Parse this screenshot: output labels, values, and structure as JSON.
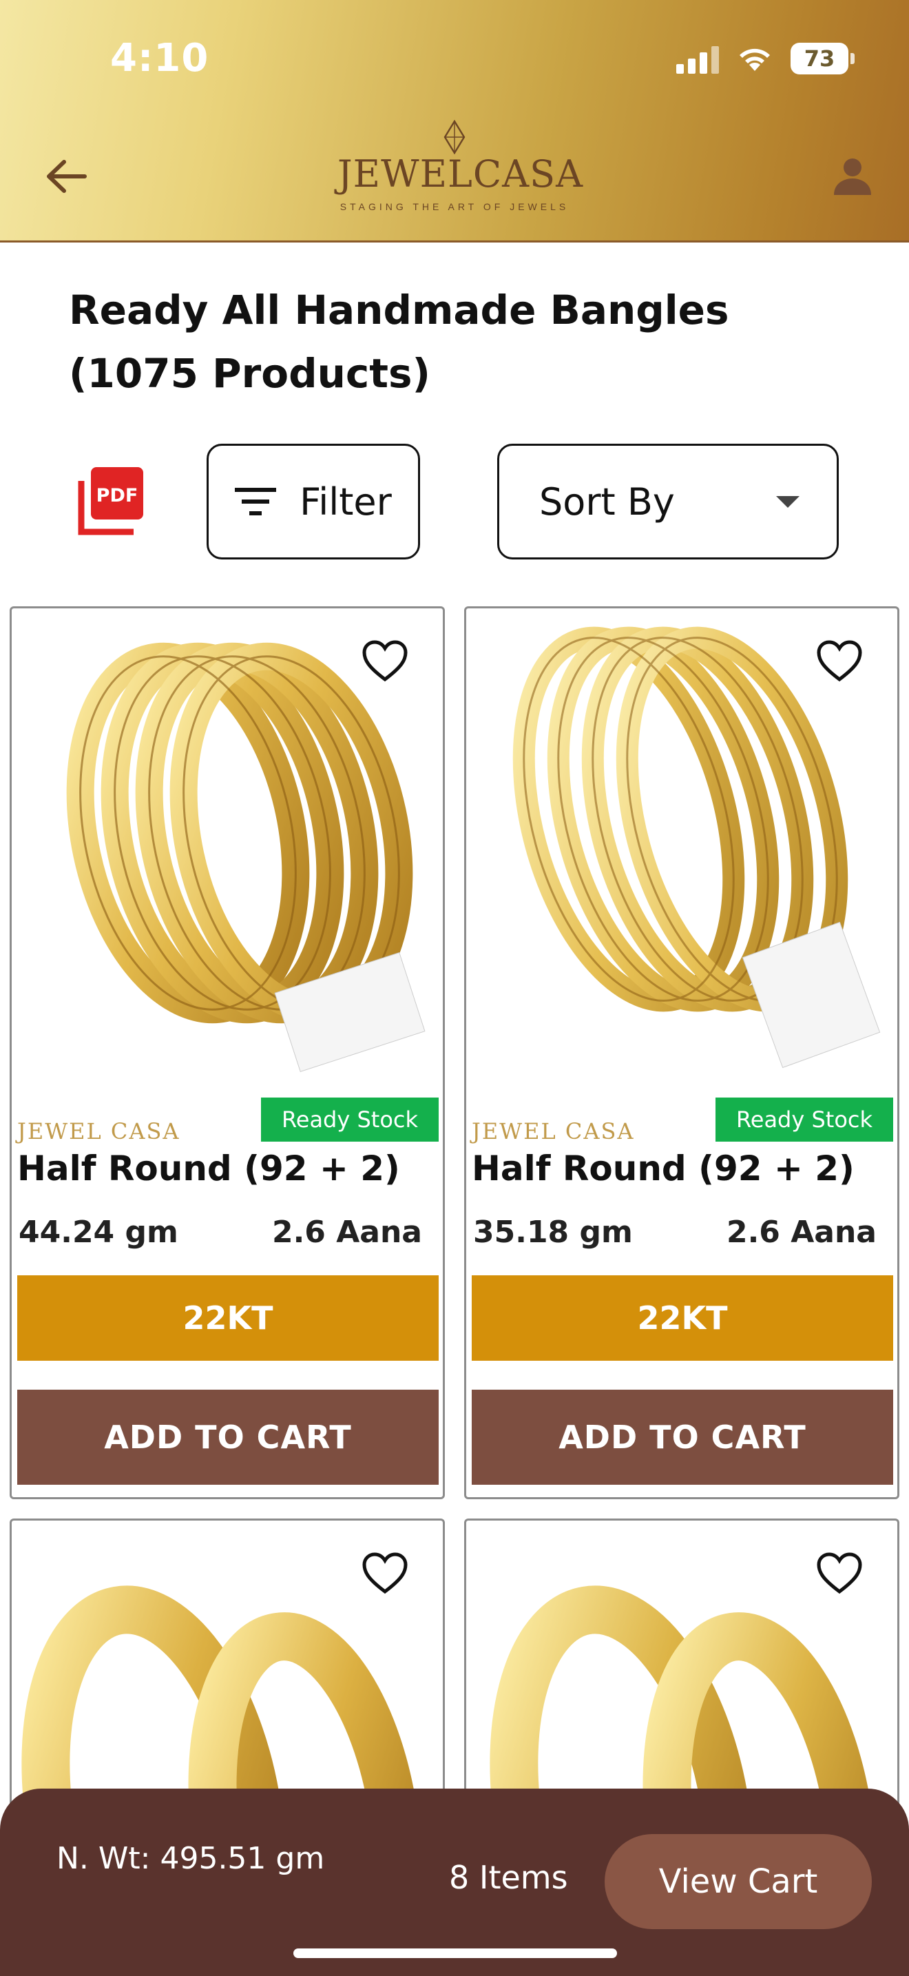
{
  "status_bar": {
    "time": "4:10",
    "battery": "73"
  },
  "header": {
    "logo_text": "JEWELCASA",
    "logo_tagline": "STAGING THE ART OF JEWELS"
  },
  "page": {
    "title": "Ready All Handmade Bangles (1075 Products)"
  },
  "toolbar": {
    "pdf_label": "PDF",
    "filter_label": "Filter",
    "sort_label": "Sort By"
  },
  "products": [
    {
      "brand": "JEWEL CASA",
      "badge": "Ready Stock",
      "name": "Half Round (92 + 2)",
      "weight": "44.24 gm",
      "aana": "2.6 Aana",
      "karat": "22KT",
      "cart_label": "ADD TO CART"
    },
    {
      "brand": "JEWEL CASA",
      "badge": "Ready Stock",
      "name": "Half Round (92 + 2)",
      "weight": "35.18 gm",
      "aana": "2.6 Aana",
      "karat": "22KT",
      "cart_label": "ADD TO CART"
    }
  ],
  "cart_bar": {
    "net_weight": "N. Wt: 495.51 gm",
    "items": "8 Items",
    "view_cart": "View Cart"
  },
  "colors": {
    "gold": "#d4900a",
    "brown": "#7d4e40",
    "bar": "#5a332d",
    "ready": "#14b04c"
  },
  "icons": [
    "back-arrow-icon",
    "user-icon",
    "pdf-icon",
    "filter-icon",
    "chevron-down-icon",
    "heart-icon"
  ]
}
